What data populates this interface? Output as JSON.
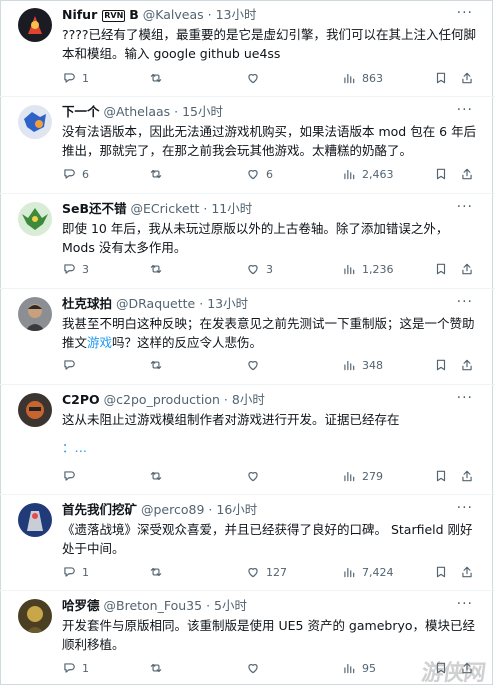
{
  "tweets": [
    {
      "name": "Nifur",
      "badge": "RVN",
      "name_suffix": "B",
      "handle": "@Kalveas",
      "dot": "·",
      "time": "13小时",
      "text": "????已经有了模组，最重要的是它是虚幻引擎，我们可以在其上注入任何脚本和模组。输入 google github ue4ss",
      "replies": "1",
      "retweets": "",
      "likes": "",
      "views": "863"
    },
    {
      "name": "下一个",
      "handle": "@Athelaas",
      "dot": "·",
      "time": "15小时",
      "text": "没有法语版本，因此无法通过游戏机购买，如果法语版本 mod 包在 6 年后推出，那就完了，在那之前我会玩其他游戏。太糟糕的奶酪了。",
      "replies": "6",
      "retweets": "",
      "likes": "6",
      "views": "2,463"
    },
    {
      "name": "SeB还不错",
      "handle": "@ECrickett",
      "dot": "·",
      "time": "11小时",
      "text": "即使 10 年后，我从未玩过原版以外的上古卷轴。除了添加错误之外，Mods 没有太多作用。",
      "replies": "3",
      "retweets": "",
      "likes": "3",
      "views": "1,236"
    },
    {
      "name": "杜克球拍",
      "handle": "@DRaquette",
      "dot": "·",
      "time": "13小时",
      "text_a": "我甚至不明白这种反映；在发表意见之前先测试一下重制版；这是一个赞助推文",
      "text_link": "游戏",
      "text_b": "吗？这样的反应令人悲伤。",
      "replies": "",
      "retweets": "",
      "likes": "",
      "views": "348"
    },
    {
      "name": "C2PO",
      "handle": "@c2po_production",
      "dot": "·",
      "time": "8小时",
      "text": "这从未阻止过游戏模组制作者对游戏进行开发。证据已经存在",
      "link_line": "：…",
      "replies": "",
      "retweets": "",
      "likes": "",
      "views": "279"
    },
    {
      "name": "首先我们挖矿",
      "handle": "@perco89",
      "dot": "·",
      "time": "16小时",
      "text": "《遗落战境》深受观众喜爱，并且已经获得了良好的口碑。 Starfield 刚好处于中间。",
      "replies": "1",
      "retweets": "",
      "likes": "127",
      "views": "7,424"
    },
    {
      "name": "哈罗德",
      "handle": "@Breton_Fou35",
      "dot": "·",
      "time": "5小时",
      "text": "开发套件与原版相同。该重制版是使用 UE5 资产的 gamebryo，模块已经顺利移植。",
      "replies": "1",
      "retweets": "",
      "likes": "",
      "views": "95"
    }
  ],
  "more_label": "···",
  "watermark": "游侠网",
  "icons": [
    "reply-icon",
    "retweet-icon",
    "like-icon",
    "views-icon",
    "bookmark-icon",
    "share-icon"
  ]
}
